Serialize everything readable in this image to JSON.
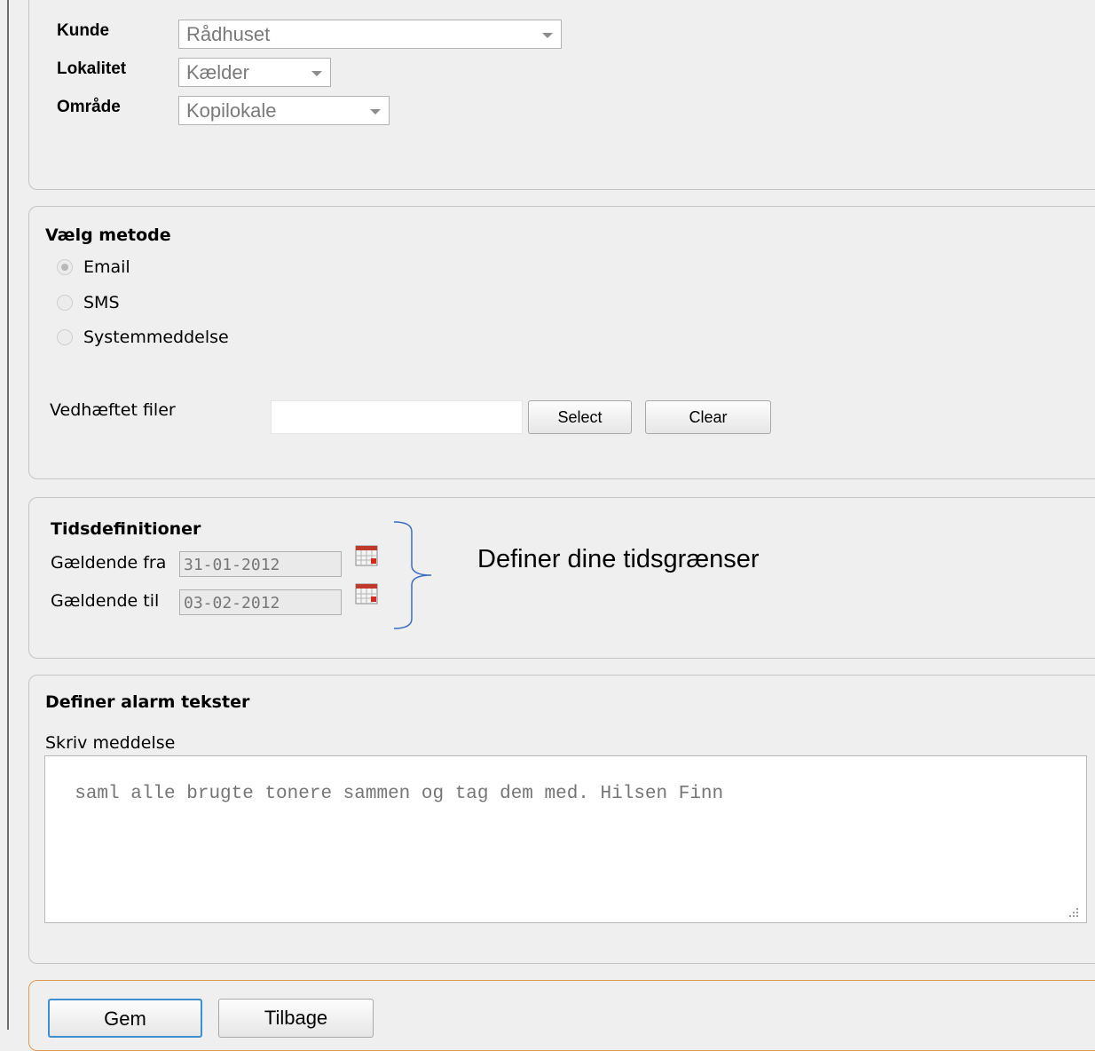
{
  "filters": {
    "kunde": {
      "label": "Kunde",
      "value": "Rådhuset"
    },
    "lokalitet": {
      "label": "Lokalitet",
      "value": "Kælder"
    },
    "omraade": {
      "label": "Område",
      "value": "Kopilokale"
    }
  },
  "method": {
    "title": "Vælg metode",
    "options": [
      {
        "label": "Email",
        "checked": true
      },
      {
        "label": "SMS",
        "checked": false
      },
      {
        "label": "Systemmeddelse",
        "checked": false
      }
    ],
    "attachment": {
      "label": "Vedhæftet filer",
      "value": "",
      "select_label": "Select",
      "clear_label": "Clear"
    }
  },
  "time": {
    "title": "Tidsdefinitioner",
    "from_label": "Gældende fra",
    "from_value": "31-01-2012",
    "to_label": "Gældende til",
    "to_value": "03-02-2012",
    "annotation": "Definer dine tidsgrænser"
  },
  "alarm": {
    "title": "Definer alarm tekster",
    "message_label": "Skriv meddelse",
    "message_value": "saml alle brugte tonere sammen og tag dem med. Hilsen Finn"
  },
  "actions": {
    "save_label": "Gem",
    "back_label": "Tilbage"
  },
  "colors": {
    "accent_border": "#e19a4c",
    "save_button_border": "#3d8fd0",
    "annotation_bracket": "#3b6cc4"
  }
}
